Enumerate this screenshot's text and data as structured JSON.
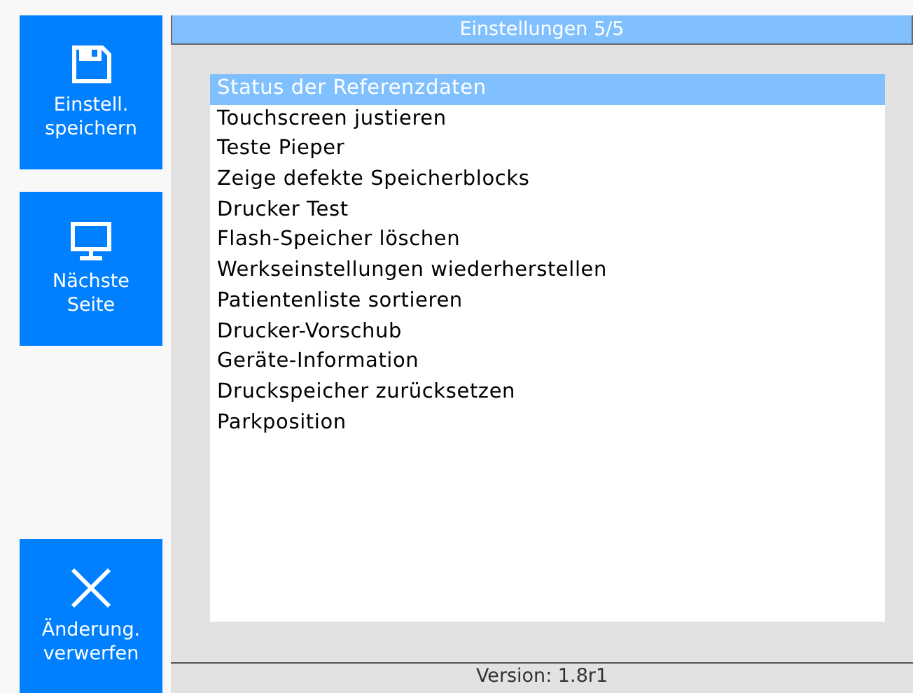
{
  "sidebar": {
    "buttons": [
      {
        "kind": "save",
        "label": [
          "Einstell.",
          "speichern"
        ]
      },
      {
        "kind": "monitor",
        "label": [
          "Nächste",
          "Seite"
        ]
      },
      {
        "kind": "discard",
        "label": [
          "Änderung.",
          "verwerfen"
        ]
      }
    ]
  },
  "title": "Einstellungen 5/5",
  "menu": {
    "items": [
      {
        "label": "Status der Referenzdaten",
        "selected": true
      },
      {
        "label": "Touchscreen justieren",
        "selected": false
      },
      {
        "label": "Teste Pieper",
        "selected": false
      },
      {
        "label": "Zeige defekte Speicherblocks",
        "selected": false
      },
      {
        "label": "Drucker Test",
        "selected": false
      },
      {
        "label": "Flash-Speicher löschen",
        "selected": false
      },
      {
        "label": "Werkseinstellungen wiederherstellen",
        "selected": false
      },
      {
        "label": "Patientenliste sortieren",
        "selected": false
      },
      {
        "label": "Drucker-Vorschub",
        "selected": false
      },
      {
        "label": "Geräte-Information",
        "selected": false
      },
      {
        "label": "Druckspeicher zurücksetzen",
        "selected": false
      },
      {
        "label": "Parkposition",
        "selected": false
      }
    ]
  },
  "status_bar": "Version: 1.8r1"
}
